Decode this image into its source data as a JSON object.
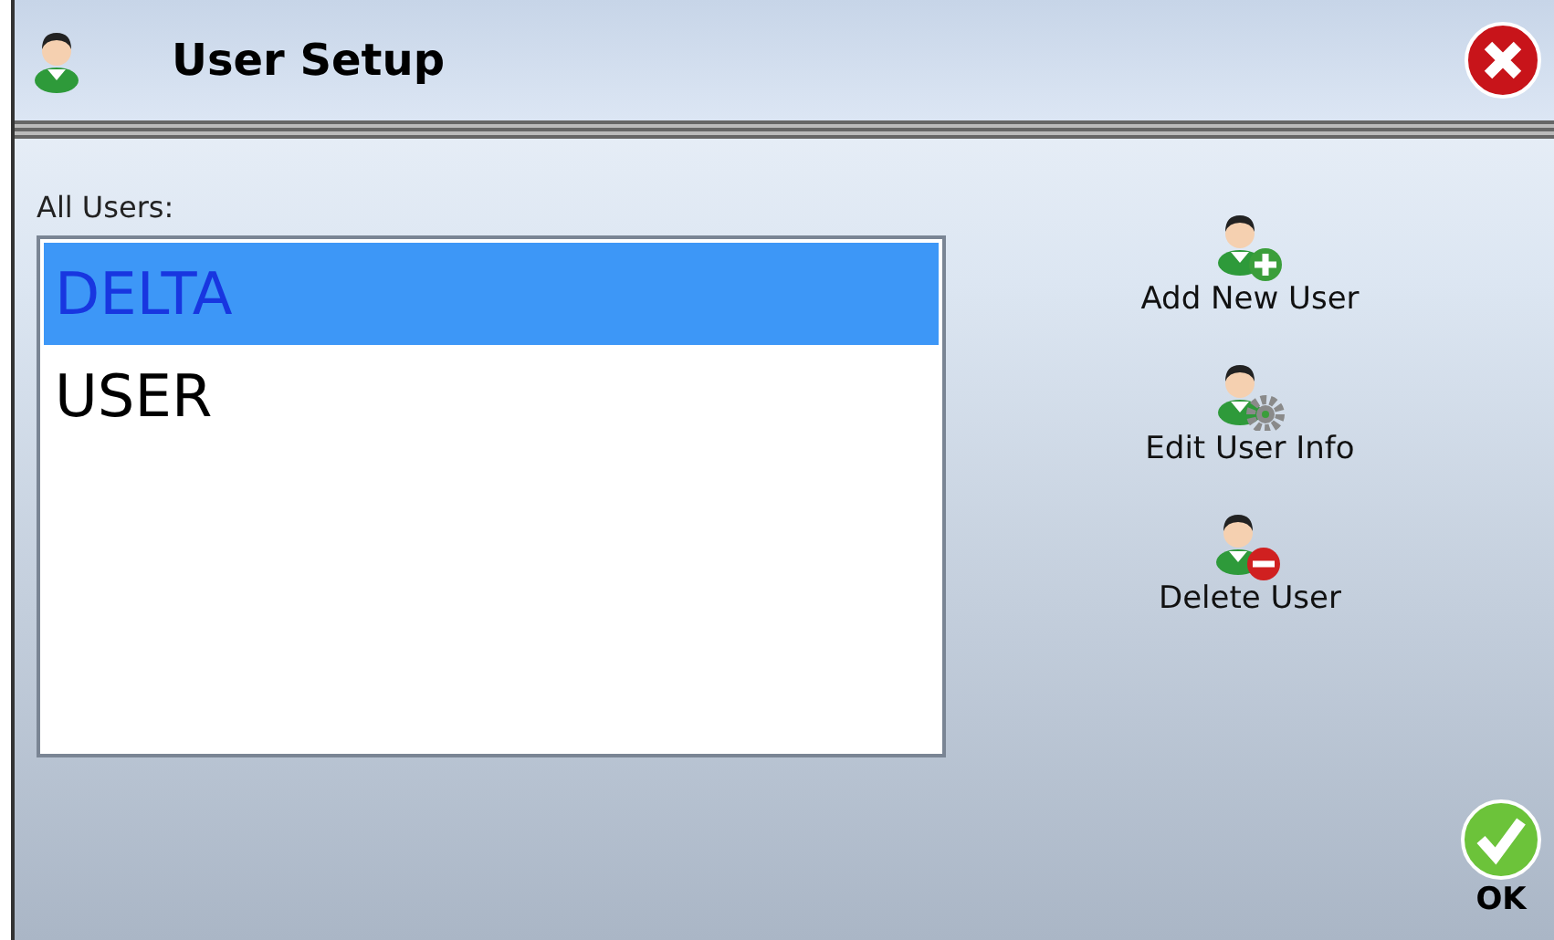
{
  "window": {
    "title": "User Setup"
  },
  "users": {
    "label": "All Users:",
    "items": [
      {
        "name": "DELTA",
        "selected": true
      },
      {
        "name": "USER",
        "selected": false
      }
    ]
  },
  "actions": [
    {
      "kind": "add",
      "label": "Add New User"
    },
    {
      "kind": "edit",
      "label": "Edit User Info"
    },
    {
      "kind": "delete",
      "label": "Delete User"
    }
  ],
  "ok": {
    "label": "OK"
  }
}
